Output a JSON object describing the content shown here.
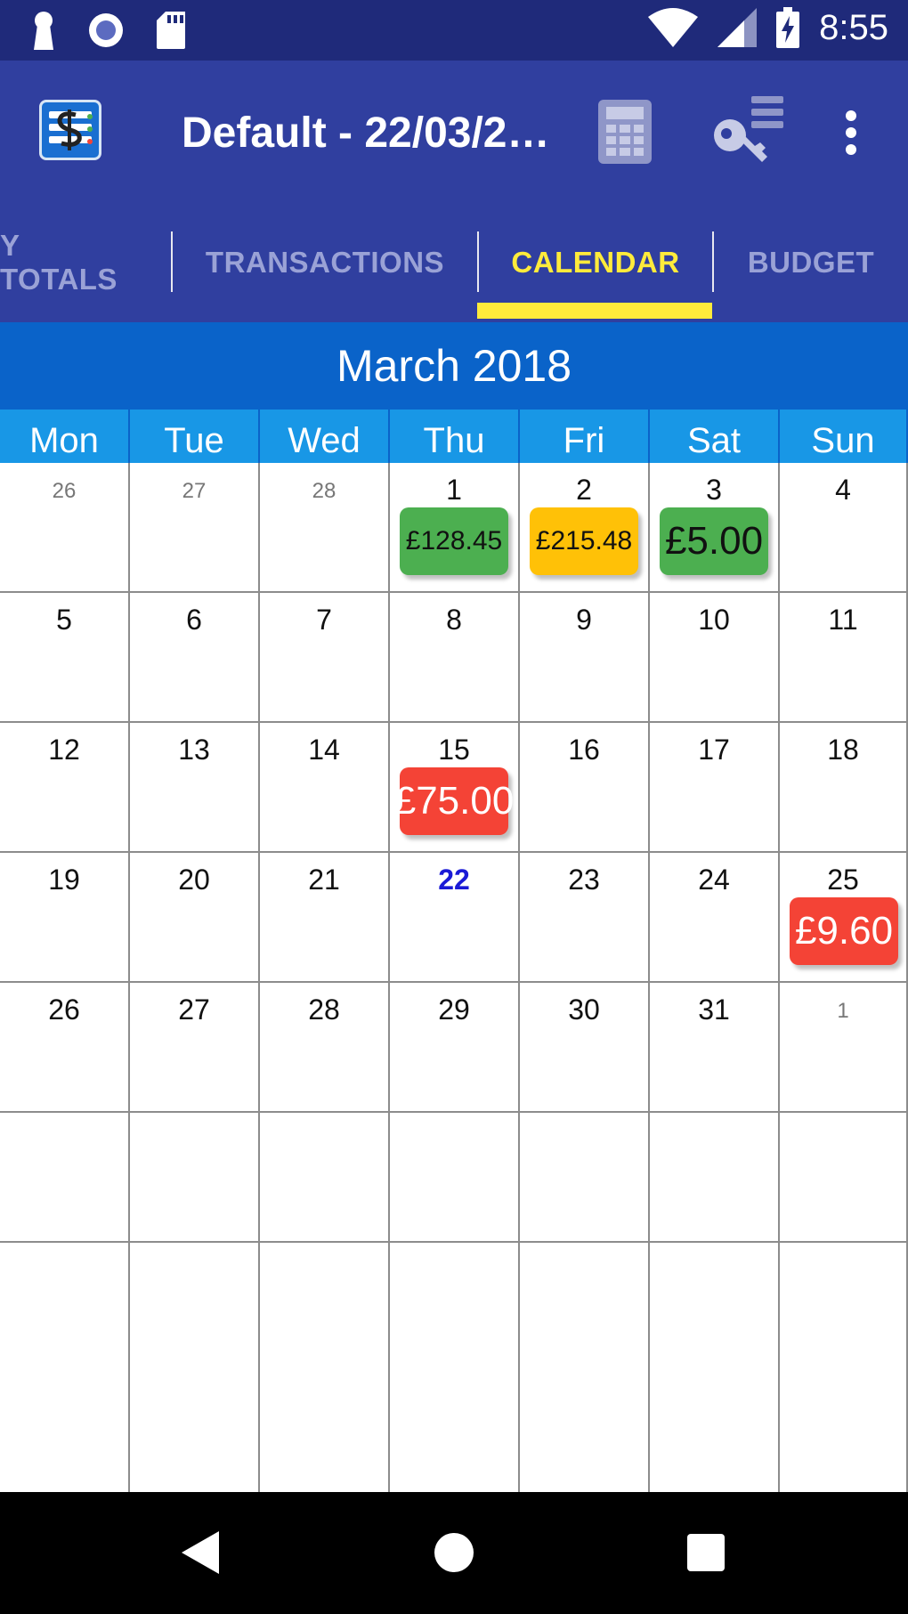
{
  "status_bar": {
    "time": "8:55",
    "left_icons": [
      "keyhole-icon",
      "record-icon",
      "sd-card-icon"
    ],
    "right_icons": [
      "wifi-icon",
      "signal-icon",
      "battery-charging-icon"
    ]
  },
  "app_bar": {
    "title": "Default - 22/03/2…",
    "icons": [
      "app-logo-icon",
      "calculator-icon",
      "key-list-icon",
      "more-vert-icon"
    ]
  },
  "tabs": [
    {
      "label": "Y TOTALS",
      "active": false
    },
    {
      "label": "TRANSACTIONS",
      "active": false
    },
    {
      "label": "CALENDAR",
      "active": true
    },
    {
      "label": "BUDGET",
      "active": false
    }
  ],
  "calendar": {
    "month_label": "March 2018",
    "weekdays": [
      "Mon",
      "Tue",
      "Wed",
      "Thu",
      "Fri",
      "Sat",
      "Sun"
    ],
    "weeks": [
      [
        {
          "day": "26",
          "other": true
        },
        {
          "day": "27",
          "other": true
        },
        {
          "day": "28",
          "other": true
        },
        {
          "day": "1",
          "amount": "£128.45",
          "color": "green",
          "size": "small"
        },
        {
          "day": "2",
          "amount": "£215.48",
          "color": "amber",
          "size": "small"
        },
        {
          "day": "3",
          "amount": "£5.00",
          "color": "green",
          "size": "big"
        },
        {
          "day": "4"
        }
      ],
      [
        {
          "day": "5"
        },
        {
          "day": "6"
        },
        {
          "day": "7"
        },
        {
          "day": "8"
        },
        {
          "day": "9"
        },
        {
          "day": "10"
        },
        {
          "day": "11"
        }
      ],
      [
        {
          "day": "12"
        },
        {
          "day": "13"
        },
        {
          "day": "14"
        },
        {
          "day": "15",
          "amount": "£75.00",
          "color": "red",
          "size": "big"
        },
        {
          "day": "16"
        },
        {
          "day": "17"
        },
        {
          "day": "18"
        }
      ],
      [
        {
          "day": "19"
        },
        {
          "day": "20"
        },
        {
          "day": "21"
        },
        {
          "day": "22",
          "today": true
        },
        {
          "day": "23"
        },
        {
          "day": "24"
        },
        {
          "day": "25",
          "amount": "£9.60",
          "color": "red",
          "size": "big"
        }
      ],
      [
        {
          "day": "26"
        },
        {
          "day": "27"
        },
        {
          "day": "28"
        },
        {
          "day": "29"
        },
        {
          "day": "30"
        },
        {
          "day": "31"
        },
        {
          "day": "1",
          "other": true
        }
      ],
      [
        {
          "day": ""
        },
        {
          "day": ""
        },
        {
          "day": ""
        },
        {
          "day": ""
        },
        {
          "day": ""
        },
        {
          "day": ""
        },
        {
          "day": ""
        }
      ],
      [
        {
          "day": ""
        },
        {
          "day": ""
        },
        {
          "day": ""
        },
        {
          "day": ""
        },
        {
          "day": ""
        },
        {
          "day": ""
        },
        {
          "day": ""
        }
      ]
    ]
  },
  "colors": {
    "status_bar": "#1f2a7a",
    "app_bar": "#303f9f",
    "active_tab": "#ffeb3b",
    "month_header": "#0a63c9",
    "weekday_header": "#1897e6",
    "green": "#4caf50",
    "amber": "#ffc107",
    "red": "#f44336",
    "today": "#1a1ad6"
  },
  "nav_bar": {
    "icons": [
      "back-icon",
      "home-icon",
      "recent-apps-icon"
    ]
  }
}
